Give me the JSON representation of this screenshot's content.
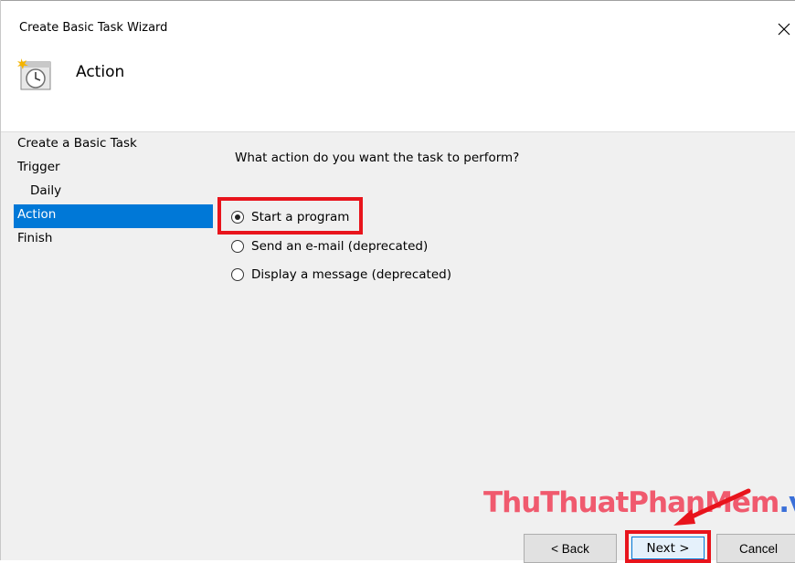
{
  "window": {
    "title": "Create Basic Task Wizard"
  },
  "header": {
    "title": "Action",
    "icon": "task-clock-icon"
  },
  "steps": [
    {
      "label": "Create a Basic Task",
      "active": false,
      "sub": false
    },
    {
      "label": "Trigger",
      "active": false,
      "sub": false
    },
    {
      "label": "Daily",
      "active": false,
      "sub": true
    },
    {
      "label": "Action",
      "active": true,
      "sub": false
    },
    {
      "label": "Finish",
      "active": false,
      "sub": false
    }
  ],
  "content": {
    "question": "What action do you want the task to perform?",
    "options": [
      {
        "label": "Start a program",
        "checked": true
      },
      {
        "label": "Send an e-mail (deprecated)",
        "checked": false
      },
      {
        "label": "Display a message (deprecated)",
        "checked": false
      }
    ]
  },
  "buttons": {
    "back": "< Back",
    "next": "Next >",
    "cancel": "Cancel"
  },
  "watermark": {
    "text": "ThuThuatPhanMem",
    "suffix": ".vn"
  },
  "colors": {
    "accent": "#0078d7",
    "highlight": "#e8141c"
  }
}
